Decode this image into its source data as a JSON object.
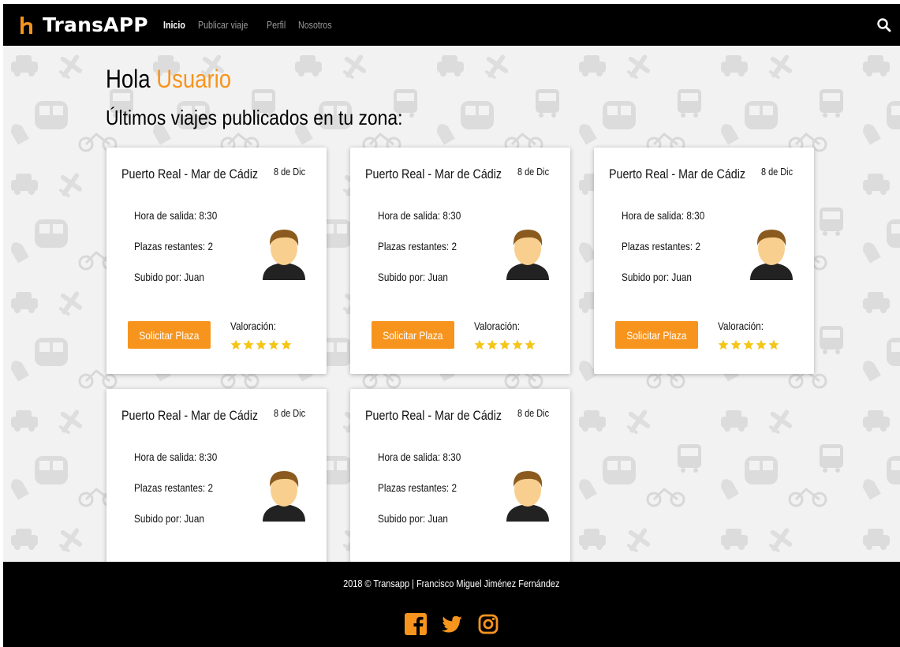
{
  "brand": {
    "name": "TransAPP",
    "logo_icon": "logo-mark-icon"
  },
  "nav": {
    "items": [
      {
        "label": "Inicio",
        "active": true
      },
      {
        "label": "Publicar viaje",
        "active": false
      },
      {
        "label": "Perfil",
        "active": false
      },
      {
        "label": "Nosotros",
        "active": false
      }
    ],
    "search_icon": "search-icon"
  },
  "greeting": {
    "prefix": "Hola",
    "user": "Usuario"
  },
  "subtitle": "Últimos viajes publicados en tu zona:",
  "cards": [
    {
      "route": "Puerto Real - Mar de Cádiz",
      "date": "8 de Dic",
      "hora": "Hora de salida: 8:30",
      "plazas": "Plazas restantes: 2",
      "subido": "Subido por: Juan",
      "button": "Solicitar Plaza",
      "valoracion_label": "Valoración:",
      "rating": 5
    },
    {
      "route": "Puerto Real - Mar de Cádiz",
      "date": "8 de Dic",
      "hora": "Hora de salida: 8:30",
      "plazas": "Plazas restantes: 2",
      "subido": "Subido por: Juan",
      "button": "Solicitar Plaza",
      "valoracion_label": "Valoración:",
      "rating": 5
    },
    {
      "route": "Puerto Real - Mar de Cádiz",
      "date": "8 de Dic",
      "hora": "Hora de salida: 8:30",
      "plazas": "Plazas restantes: 2",
      "subido": "Subido por: Juan",
      "button": "Solicitar Plaza",
      "valoracion_label": "Valoración:",
      "rating": 5
    },
    {
      "route": "Puerto Real - Mar de Cádiz",
      "date": "8 de Dic",
      "hora": "Hora de salida: 8:30",
      "plazas": "Plazas restantes: 2",
      "subido": "Subido por: Juan"
    },
    {
      "route": "Puerto Real - Mar de Cádiz",
      "date": "8 de Dic",
      "hora": "Hora de salida: 8:30",
      "plazas": "Plazas restantes: 2",
      "subido": "Subido por: Juan"
    }
  ],
  "footer": {
    "text": "2018 © Transapp | Francisco Miguel Jiménez Fernández",
    "social_icons": [
      "facebook-icon",
      "twitter-icon",
      "instagram-icon"
    ]
  },
  "colors": {
    "accent": "#f7941d",
    "star": "#f5c518",
    "nav_bg": "#000000"
  }
}
